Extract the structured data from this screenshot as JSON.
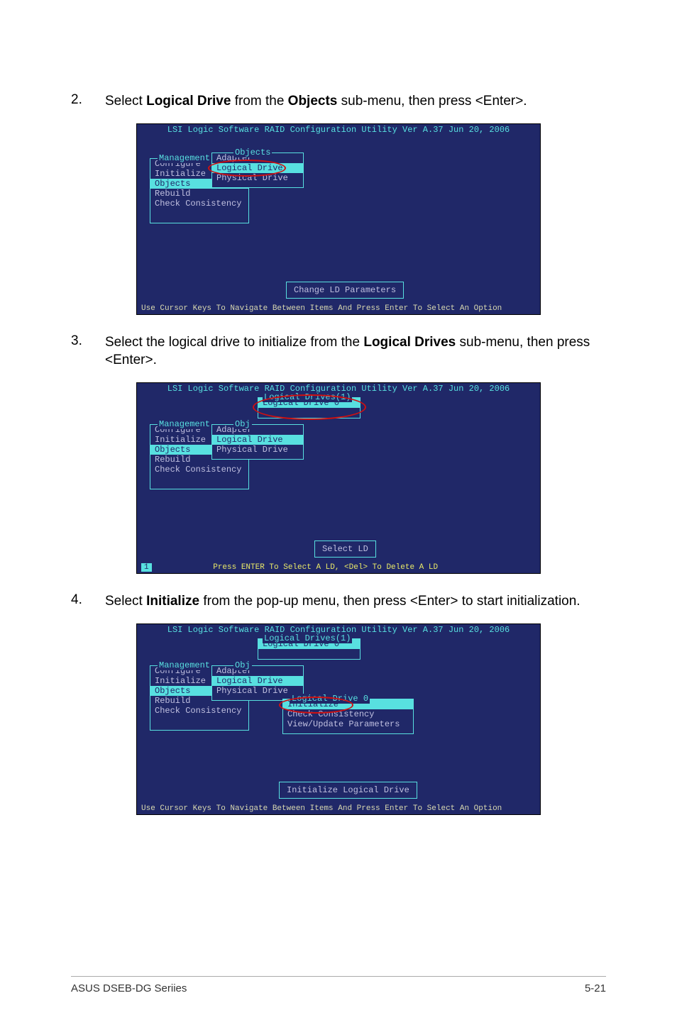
{
  "steps": {
    "s2": {
      "num": "2.",
      "pre": "Select ",
      "bold1": "Logical Drive",
      "mid": " from the ",
      "bold2": "Objects",
      "post": " sub-menu, then press <Enter>."
    },
    "s3": {
      "num": "3.",
      "pre": "Select the logical drive to initialize from the ",
      "bold1": "Logical Drives",
      "post": " sub-menu, then press <Enter>."
    },
    "s4": {
      "num": "4.",
      "pre": "Select ",
      "bold1": "Initialize",
      "post": " from the pop-up menu, then press <Enter> to start initialization."
    }
  },
  "shot": {
    "title": "LSI Logic Software RAID Configuration Utility Ver A.37 Jun 20, 2006",
    "mgmt_title": "Management",
    "objects_title": "Objects",
    "obj_abbrev": "Obj",
    "mgmt_items": {
      "configure": "Configure",
      "initialize": "Initialize",
      "objects": "Objects",
      "rebuild": "Rebuild",
      "check": "Check Consistency"
    },
    "obj_items": {
      "adapter": "Adapter",
      "logical": "Logical Drive",
      "physical": "Physical Drive"
    },
    "logdrives_title": "Logical Drives(1)",
    "logdrive0": "Logical Drive 0",
    "ld0_menu_title": "Logical Drive 0",
    "ld0_menu": {
      "init": "Initialize",
      "check": "Check Consistency",
      "view": "View/Update Parameters"
    },
    "box1": "Change LD Parameters",
    "box2": "Select LD",
    "box3": "Initialize Logical Drive",
    "footer1": "Use Cursor Keys To Navigate Between Items And Press Enter To Select An Option",
    "footer2a": "1",
    "footer2": "Press ENTER To Select A LD, <Del> To Delete A LD"
  },
  "footer": {
    "left": "ASUS DSEB-DG Seriies",
    "right": "5-21"
  }
}
